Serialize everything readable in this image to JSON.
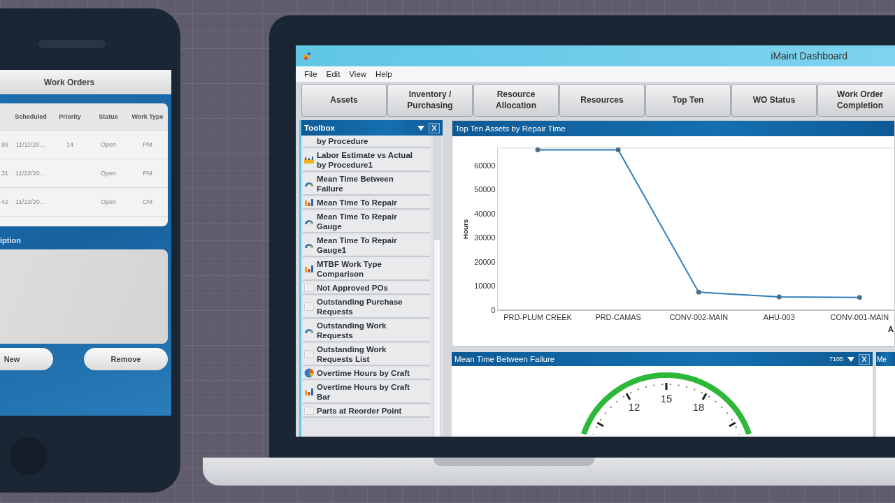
{
  "phone": {
    "title": "Work Orders",
    "columns": [
      "Scheduled",
      "Priority",
      "Status",
      "Work Type"
    ],
    "rows": [
      {
        "id": "88",
        "scheduled": "11/11/20…",
        "priority": "14",
        "status": "Open",
        "work_type": "PM"
      },
      {
        "id": "31",
        "scheduled": "11/22/20…",
        "status": "Open",
        "work_type": "PM"
      },
      {
        "id": "42",
        "scheduled": "11/22/20…",
        "status": "Open",
        "work_type": "CM"
      }
    ],
    "description_label": "iption",
    "buttons": [
      "New",
      "Remove"
    ]
  },
  "laptop": {
    "window": {
      "title": "iMaint Dashboard"
    },
    "menu": [
      "File",
      "Edit",
      "View",
      "Help"
    ],
    "toolbar": [
      "Assets",
      "Inventory / Purchasing",
      "Resource Allocation",
      "Resources",
      "Top Ten",
      "WO Status",
      "Work Order Completion"
    ],
    "toolbox": {
      "title": "Toolbox",
      "items": [
        {
          "label": "by Procedure",
          "kind": "none"
        },
        {
          "label": "Labor Estimate vs Actual by Procedure1",
          "kind": "columns"
        },
        {
          "label": "Mean Time Between Failure",
          "kind": "gauge"
        },
        {
          "label": "Mean Time To Repair",
          "kind": "bar"
        },
        {
          "label": "Mean Time To Repair Gauge",
          "kind": "gauge"
        },
        {
          "label": "Mean Time To Repair Gauge1",
          "kind": "gauge"
        },
        {
          "label": "MTBF Work Type Comparison",
          "kind": "bar"
        },
        {
          "label": "Not Approved POs",
          "kind": "grid"
        },
        {
          "label": "Outstanding Purchase Requests",
          "kind": "grid"
        },
        {
          "label": "Outstanding Work Requests",
          "kind": "gauge"
        },
        {
          "label": "Outstanding Work Requests List",
          "kind": "grid"
        },
        {
          "label": "Overtime Hours by Craft",
          "kind": "pie"
        },
        {
          "label": "Overtime Hours by Craft Bar",
          "kind": "bar"
        },
        {
          "label": "Parts at Reorder Point",
          "kind": "grid"
        }
      ]
    },
    "top_chart": {
      "title": "Top Ten Assets by Repair Time",
      "chart_data": {
        "type": "line",
        "ylabel": "Hours",
        "xlabel": "A",
        "categories": [
          "PRD-PLUM CREEK",
          "PRD-CAMAS",
          "CONV-002-MAIN",
          "AHU-003",
          "CONV-001-MAIN"
        ],
        "series": [
          {
            "color": "#2b7bb9",
            "marker": true,
            "values": [
              66500,
              66500,
              7500,
              5500,
              5300
            ]
          }
        ],
        "ylim": [
          0,
          67000
        ],
        "yticks": [
          0,
          10000,
          20000,
          30000,
          40000,
          50000,
          60000
        ]
      }
    },
    "gauge_panel": {
      "title": "Mean Time Between Failure",
      "value": "7105",
      "scale_labels": [
        "12",
        "15",
        "18"
      ]
    },
    "next_panel": {
      "title": "Me"
    }
  }
}
